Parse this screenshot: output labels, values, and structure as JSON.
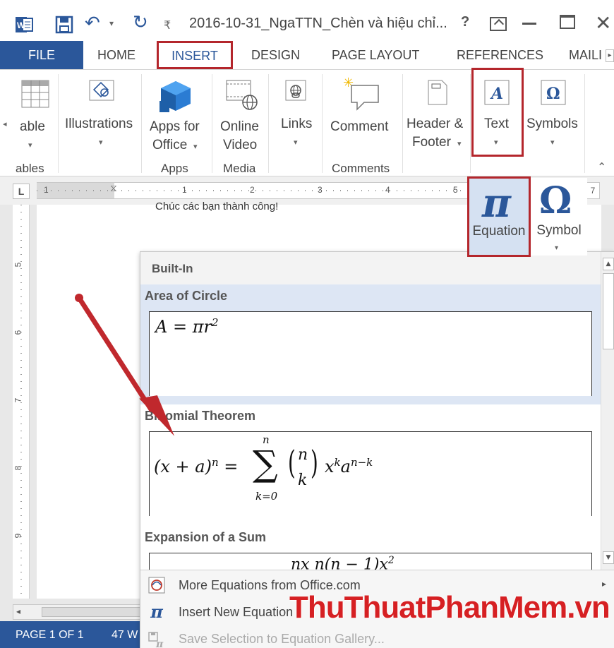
{
  "window": {
    "title": "2016-10-31_NgaTTN_Chèn và hiệu chỉ...",
    "help": "?",
    "close": "✕"
  },
  "tabs": {
    "file": "FILE",
    "home": "HOME",
    "insert": "INSERT",
    "design": "DESIGN",
    "page_layout": "PAGE LAYOUT",
    "references": "REFERENCES",
    "mailings": "MAILI"
  },
  "ribbon": {
    "table_label": "able",
    "illustrations_label": "Illustrations",
    "apps_label_1": "Apps for",
    "apps_label_2": "Office",
    "online_video_1": "Online",
    "online_video_2": "Video",
    "links_label": "Links",
    "comment_label": "Comment",
    "header_footer_1": "Header &",
    "header_footer_2": "Footer",
    "text_label": "Text",
    "symbols_label": "Symbols",
    "groups": {
      "tables": "ables",
      "apps": "Apps",
      "media": "Media",
      "comments": "Comments"
    }
  },
  "ruler": {
    "tab_selector": "L",
    "numbers": [
      "1",
      "1",
      "2",
      "3",
      "4",
      "5"
    ],
    "right_number": "7"
  },
  "vruler": {
    "numbers": [
      "5",
      "6",
      "7",
      "8",
      "9"
    ]
  },
  "document": {
    "text": "Chúc các bạn thành công!"
  },
  "text_group": {
    "equation_label": "Equation",
    "symbol_label": "Symbol"
  },
  "gallery": {
    "header": "Built-In",
    "items": [
      {
        "title": "Area of Circle"
      },
      {
        "title": "Binomial Theorem"
      },
      {
        "title": "Expansion of a Sum"
      }
    ]
  },
  "menu": {
    "more_equations": "More Equations from Office.com",
    "insert_new": "Insert New Equation",
    "save_selection": "Save Selection to Equation Gallery..."
  },
  "status": {
    "page": "PAGE 1 OF 1",
    "words": "47 W"
  },
  "watermark": "ThuThuatPhanMem.vn",
  "colors": {
    "accent": "#2b579a",
    "highlight_box": "#b4262c",
    "arrow": "#c0282d",
    "selected_item": "#dde6f4"
  }
}
